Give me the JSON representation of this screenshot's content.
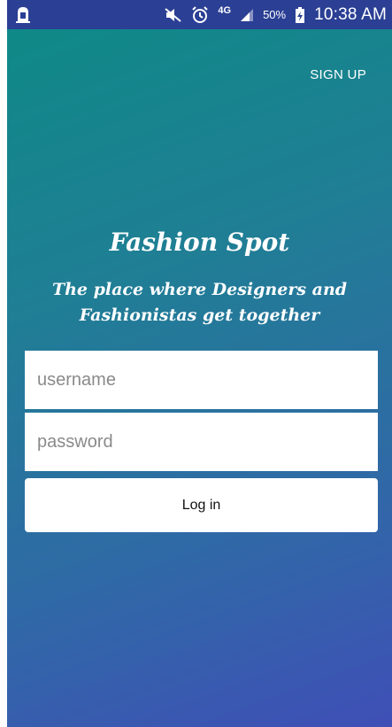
{
  "status_bar": {
    "battery": "50%",
    "time": "10:38 AM",
    "network": "4G",
    "icons": [
      "notification-icon",
      "mute-icon",
      "alarm-icon",
      "network-4g-icon",
      "signal-icon",
      "battery-charging-icon"
    ]
  },
  "header": {
    "signup_label": "SIGN UP"
  },
  "brand": {
    "title": "Fashion Spot",
    "tagline_line1": "The place where Designers and",
    "tagline_line2": "Fashionistas get together"
  },
  "form": {
    "username_placeholder": "username",
    "username_value": "",
    "password_placeholder": "password",
    "password_value": "",
    "login_label": "Log in"
  },
  "colors": {
    "gradient_top": "#0d8a86",
    "gradient_bottom": "#3f4fb6",
    "status_bar": "#2b3f94",
    "field_bg": "#ffffff"
  }
}
